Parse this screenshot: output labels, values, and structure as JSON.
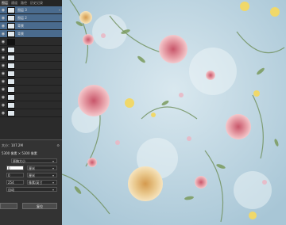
{
  "panel": {
    "tabs": [
      "图层",
      "通道",
      "路径",
      "历史记录"
    ],
    "layers": [
      {
        "name": "图层 3",
        "selected": true,
        "visible": true
      },
      {
        "name": "图层 2",
        "selected": true,
        "visible": true
      },
      {
        "name": "背景",
        "selected": true,
        "visible": true
      },
      {
        "name": "背景",
        "selected": true,
        "visible": true
      },
      {
        "name": "",
        "selected": false,
        "visible": true
      },
      {
        "name": "",
        "selected": false,
        "visible": true
      },
      {
        "name": "",
        "selected": false,
        "visible": true
      },
      {
        "name": "",
        "selected": false,
        "visible": true
      },
      {
        "name": "",
        "selected": false,
        "visible": true
      },
      {
        "name": "",
        "selected": false,
        "visible": true
      },
      {
        "name": "",
        "selected": false,
        "visible": true
      },
      {
        "name": "",
        "selected": false,
        "visible": true
      },
      {
        "name": "",
        "selected": false,
        "visible": true
      },
      {
        "name": "",
        "selected": false,
        "visible": true
      }
    ]
  },
  "properties": {
    "size_label": "大小：107.2M",
    "dims": "5300 像素 × 5300 像素",
    "mode": "原稿大小",
    "width_value": "0",
    "width_unit": "厘米",
    "height_value": "0",
    "height_unit": "厘米",
    "res_value": "254",
    "res_unit": "像素/英寸",
    "resample": "自动",
    "ok_label": "",
    "reset_label": "复位"
  },
  "colors": {
    "selected_row": "#4a6b8e",
    "canvas_bg": "#b6d0df"
  }
}
